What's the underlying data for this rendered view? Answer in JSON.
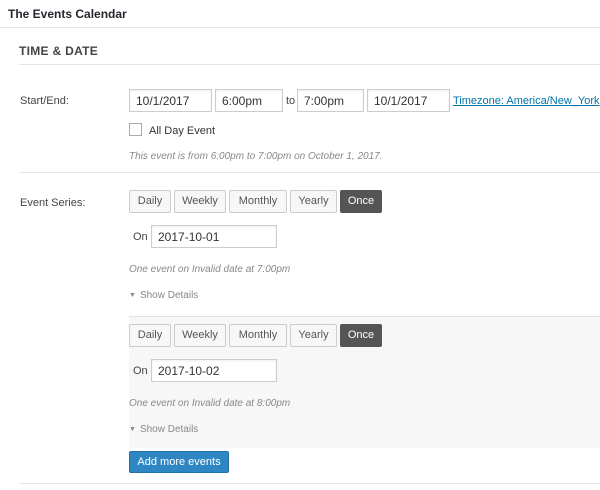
{
  "panel": {
    "title": "The Events Calendar"
  },
  "section": {
    "heading": "TIME & DATE"
  },
  "start_end": {
    "label": "Start/End:",
    "start_date": "10/1/2017",
    "start_time": "6:00pm",
    "to_label": "to",
    "end_time": "7:00pm",
    "end_date": "10/1/2017",
    "timezone_link": "Timezone: America/New_York",
    "all_day_label": "All Day Event",
    "all_day_checked": false,
    "summary": "This event is from 6:00pm to 7:00pm on October 1, 2017."
  },
  "event_series": {
    "label": "Event Series:",
    "entries": [
      {
        "buttons": [
          "Daily",
          "Weekly",
          "Monthly",
          "Yearly",
          "Once"
        ],
        "active": "Once",
        "on_label": "On",
        "on_date": "2017-10-01",
        "summary": "One event on Invalid date at 7:00pm",
        "details_label": "Show Details"
      },
      {
        "buttons": [
          "Daily",
          "Weekly",
          "Monthly",
          "Yearly",
          "Once"
        ],
        "active": "Once",
        "on_label": "On",
        "on_date": "2017-10-02",
        "summary": "One event on Invalid date at 8:00pm",
        "details_label": "Show Details"
      }
    ],
    "add_more_label": "Add more events"
  },
  "colors": {
    "primary": "#2e87c3",
    "active_toggle": "#555555",
    "link": "#0073aa"
  },
  "icons": {
    "details_toggle": "triangle-down-icon"
  }
}
